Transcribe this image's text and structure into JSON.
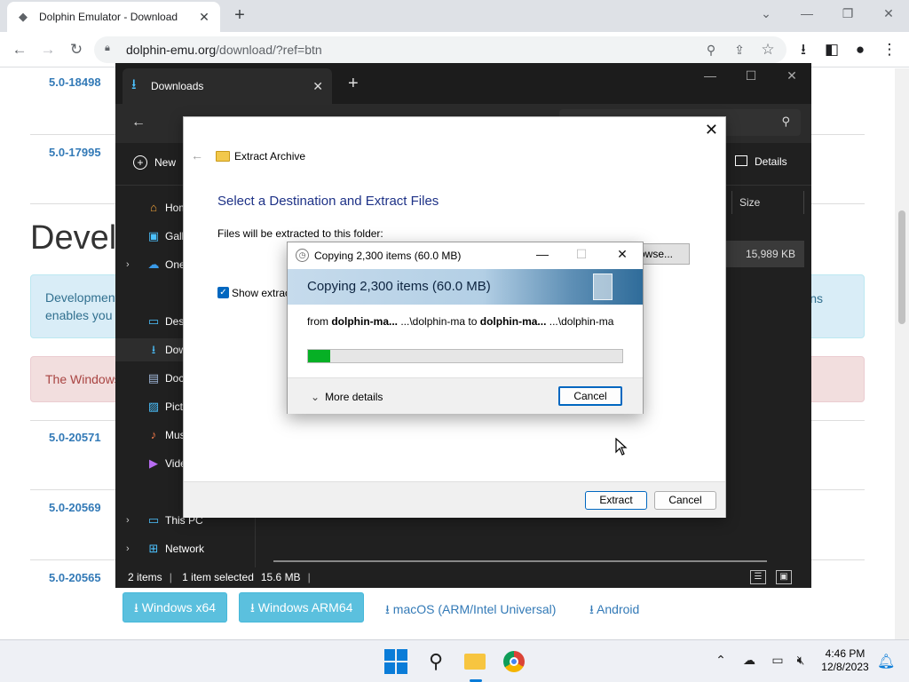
{
  "browser": {
    "tab_title": "Dolphin Emulator - Download",
    "url_host": "dolphin-emu.org",
    "url_path": "/download/?ref=btn"
  },
  "webpage": {
    "version_links": [
      "5.0-18498",
      "5.0-17995",
      "5.0-20571",
      "5.0-20569",
      "5.0-20565"
    ],
    "dev_heading": "Develo",
    "info_text_line1": "Development",
    "info_text_line2": "enables you",
    "info_text_right": "ns",
    "warning_text": "The Windows",
    "download_buttons": [
      "Windows x64",
      "Windows ARM64"
    ],
    "download_links": [
      "macOS (ARM/Intel Universal)",
      "Android"
    ]
  },
  "explorer": {
    "tab_title": "Downloads",
    "new_label": "New",
    "details_label": "Details",
    "column_size": "Size",
    "file_size": "15,989 KB",
    "nav_items": [
      {
        "label": "Home",
        "icon": "home-icon",
        "glyph": "⌂"
      },
      {
        "label": "Gallery",
        "icon": "gallery-icon",
        "glyph": "▣"
      },
      {
        "label": "OneDrive",
        "icon": "cloud-icon",
        "glyph": "☁"
      },
      {
        "label": "Desktop",
        "icon": "desktop-icon",
        "glyph": "▭"
      },
      {
        "label": "Downloads",
        "icon": "download-icon",
        "glyph": "⭳"
      },
      {
        "label": "Documents",
        "icon": "document-icon",
        "glyph": "▤"
      },
      {
        "label": "Pictures",
        "icon": "picture-icon",
        "glyph": "▨"
      },
      {
        "label": "Music",
        "icon": "music-icon",
        "glyph": "♪"
      },
      {
        "label": "Videos",
        "icon": "video-icon",
        "glyph": "▶"
      },
      {
        "label": "This PC",
        "icon": "computer-icon",
        "glyph": "▭"
      },
      {
        "label": "Network",
        "icon": "network-icon",
        "glyph": "⊞"
      }
    ],
    "status_items": "2 items",
    "status_selected": "1 item selected",
    "status_size": "15.6 MB"
  },
  "extract_dialog": {
    "title": "Extract Archive",
    "heading": "Select a Destination and Extract Files",
    "subheading": "Files will be extracted to this folder:",
    "browse_label": "owse...",
    "show_files_label": "Show extract",
    "show_files_checked": true,
    "extract_label": "Extract",
    "cancel_label": "Cancel"
  },
  "copy_dialog": {
    "title": "Copying 2,300 items (60.0 MB)",
    "banner": "Copying 2,300 items (60.0 MB)",
    "from_prefix": "from ",
    "from_source": "dolphin-ma...",
    "from_source_path": " ...\\dolphin-ma",
    "to_word": " to ",
    "to_dest": "dolphin-ma...",
    "to_dest_path": " ...\\dolphin-ma",
    "progress_fraction": 0.07,
    "more_details_label": "More details",
    "cancel_label": "Cancel",
    "progress_color": "#06b025"
  },
  "taskbar": {
    "time": "4:46 PM",
    "date": "12/8/2023"
  }
}
